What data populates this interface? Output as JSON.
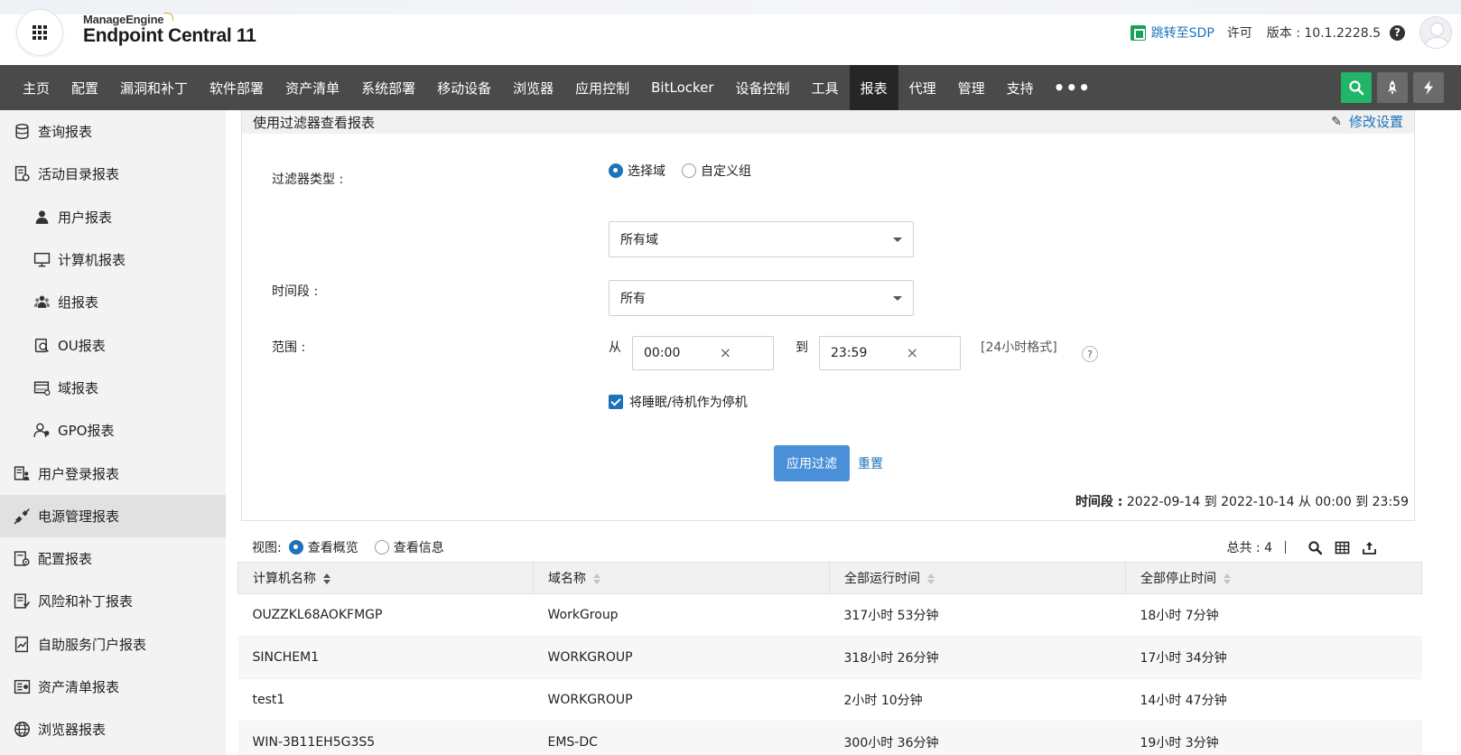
{
  "header": {
    "vendor": "ManageEngine",
    "product": "Endpoint Central 11",
    "sdp_link": "跳转至SDP",
    "license_link": "许可",
    "version": "版本 : 10.1.2228.5",
    "help": "?"
  },
  "nav": {
    "items": [
      "主页",
      "配置",
      "漏洞和补丁",
      "软件部署",
      "资产清单",
      "系统部署",
      "移动设备",
      "浏览器",
      "应用控制",
      "BitLocker",
      "设备控制",
      "工具",
      "报表",
      "代理",
      "管理",
      "支持"
    ],
    "active": "报表",
    "more": "•••"
  },
  "sidebar": {
    "items": [
      {
        "label": "查询报表",
        "icon": "database-icon",
        "level": 0
      },
      {
        "label": "活动目录报表",
        "icon": "directory-report-icon",
        "level": 0
      },
      {
        "label": "用户报表",
        "icon": "user-icon",
        "level": 1
      },
      {
        "label": "计算机报表",
        "icon": "monitor-icon",
        "level": 1
      },
      {
        "label": "组报表",
        "icon": "group-icon",
        "level": 1
      },
      {
        "label": "OU报表",
        "icon": "ou-search-icon",
        "level": 1
      },
      {
        "label": "域报表",
        "icon": "domain-www-icon",
        "level": 1
      },
      {
        "label": "GPO报表",
        "icon": "gpo-user-icon",
        "level": 1
      },
      {
        "label": "用户登录报表",
        "icon": "user-logon-icon",
        "level": 0
      },
      {
        "label": "电源管理报表",
        "icon": "power-plug-icon",
        "level": 0,
        "active": true
      },
      {
        "label": "配置报表",
        "icon": "config-report-icon",
        "level": 0
      },
      {
        "label": "风险和补丁报表",
        "icon": "risk-patch-icon",
        "level": 0
      },
      {
        "label": "自助服务门户报表",
        "icon": "self-service-icon",
        "level": 0
      },
      {
        "label": "资产清单报表",
        "icon": "inventory-icon",
        "level": 0
      },
      {
        "label": "浏览器报表",
        "icon": "globe-icon",
        "level": 0
      }
    ]
  },
  "filter": {
    "title": "使用过滤器查看报表",
    "edit_settings": "修改设置",
    "filter_type_label": "过滤器类型 :",
    "filter_type_options": [
      "选择域",
      "自定义组"
    ],
    "filter_type_selected": "选择域",
    "domain_select": "所有域",
    "period_label": "时间段 :",
    "period_select": "所有",
    "range_label": "范围 :",
    "from_label": "从",
    "from_time": "00:00",
    "to_label": "到",
    "to_time": "23:59",
    "format_hint": "[24小时格式]",
    "help": "?",
    "clear": "×",
    "sleep_checkbox": "将睡眠/待机作为停机",
    "sleep_checked": true,
    "apply_button": "应用过滤",
    "reset_link": "重置",
    "summary_label": "时间段 :",
    "summary_value": "2022-09-14 到 2022-10-14 从 00:00 到 23:59"
  },
  "view": {
    "label": "视图:",
    "options": [
      "查看概览",
      "查看信息"
    ],
    "selected": "查看概览",
    "total": "总共 : 4"
  },
  "table": {
    "columns": [
      "计算机名称",
      "域名称",
      "全部运行时间",
      "全部停止时间"
    ],
    "rows": [
      [
        "OUZZKL68AOKFMGP",
        "WorkGroup",
        "317小时 53分钟",
        "18小时 7分钟"
      ],
      [
        "SINCHEM1",
        "WORKGROUP",
        "318小时 26分钟",
        "17小时 34分钟"
      ],
      [
        "test1",
        "WORKGROUP",
        "2小时 10分钟",
        "14小时 47分钟"
      ],
      [
        "WIN-3B11EH5G3S5",
        "EMS-DC",
        "300小时 36分钟",
        "19小时 3分钟"
      ]
    ]
  },
  "colors": {
    "accent": "#1d72b8",
    "nav_bg": "#4a4a4a",
    "nav_active": "#262626",
    "search_green": "#21b567",
    "apply_blue": "#4a90d9"
  }
}
